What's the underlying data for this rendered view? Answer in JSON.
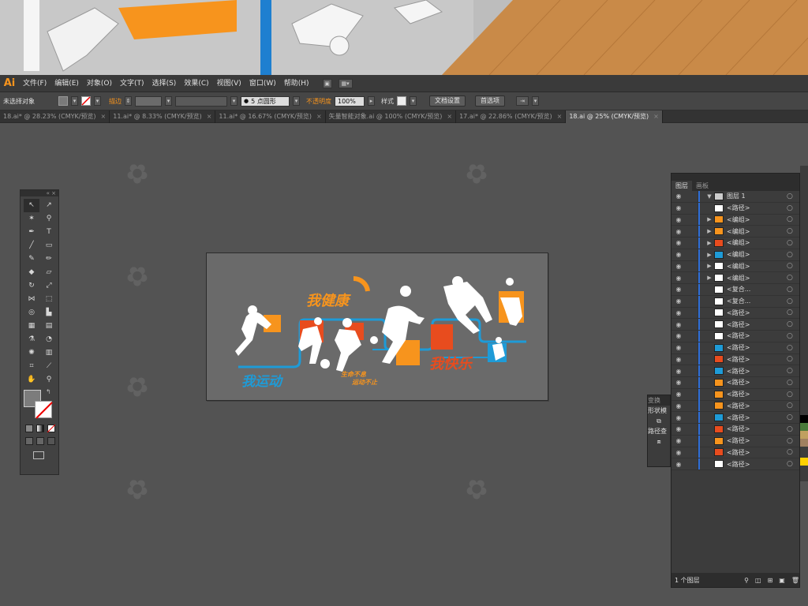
{
  "app": {
    "logo": "Ai"
  },
  "menu": [
    "文件(F)",
    "编辑(E)",
    "对象(O)",
    "文字(T)",
    "选择(S)",
    "效果(C)",
    "视图(V)",
    "窗口(W)",
    "帮助(H)"
  ],
  "control": {
    "selection": "未选择对象",
    "stroke_label": "描边",
    "point_style": "5 点圆形",
    "opacity_label": "不透明度",
    "opacity_value": "100%",
    "style_label": "样式",
    "doc_setup": "文档设置",
    "preferences": "首选项"
  },
  "tabs": [
    {
      "label": "18.ai* @ 28.23% (CMYK/预览)",
      "active": false
    },
    {
      "label": "11.ai* @ 8.33% (CMYK/预览)",
      "active": false
    },
    {
      "label": "11.ai* @ 16.67% (CMYK/预览)",
      "active": false
    },
    {
      "label": "矢量智能对象.ai @ 100% (CMYK/预览)",
      "active": false
    },
    {
      "label": "17.ai* @ 22.86% (CMYK/预览)",
      "active": false
    },
    {
      "label": "18.ai @ 25% (CMYK/预览)",
      "active": true
    }
  ],
  "artwork": {
    "title1": "我健康",
    "title2": "我快乐",
    "title3": "我运动",
    "slogan1": "生命不息",
    "slogan2": "运动不止"
  },
  "layers_panel": {
    "tab_layers": "图层",
    "tab_artboards": "画板",
    "top_layer": "图层 1",
    "rows": [
      {
        "name": "<路径>",
        "expand": false,
        "thumb": "#ffffff"
      },
      {
        "name": "<编组>",
        "expand": true,
        "thumb": "#f7941d"
      },
      {
        "name": "<编组>",
        "expand": true,
        "thumb": "#f7941d"
      },
      {
        "name": "<编组>",
        "expand": true,
        "thumb": "#e84c1e"
      },
      {
        "name": "<编组>",
        "expand": true,
        "thumb": "#1e9bd7"
      },
      {
        "name": "<编组>",
        "expand": true,
        "thumb": "#ffffff"
      },
      {
        "name": "<编组>",
        "expand": true,
        "thumb": "#ffffff"
      },
      {
        "name": "<复合...",
        "expand": false,
        "thumb": "#ffffff"
      },
      {
        "name": "<复合...",
        "expand": false,
        "thumb": "#ffffff"
      },
      {
        "name": "<路径>",
        "expand": false,
        "thumb": "#ffffff"
      },
      {
        "name": "<路径>",
        "expand": false,
        "thumb": "#ffffff"
      },
      {
        "name": "<路径>",
        "expand": false,
        "thumb": "#ffffff"
      },
      {
        "name": "<路径>",
        "expand": false,
        "thumb": "#1e9bd7"
      },
      {
        "name": "<路径>",
        "expand": false,
        "thumb": "#e84c1e"
      },
      {
        "name": "<路径>",
        "expand": false,
        "thumb": "#1e9bd7"
      },
      {
        "name": "<路径>",
        "expand": false,
        "thumb": "#f7941d"
      },
      {
        "name": "<路径>",
        "expand": false,
        "thumb": "#f7941d"
      },
      {
        "name": "<路径>",
        "expand": false,
        "thumb": "#f7941d"
      },
      {
        "name": "<路径>",
        "expand": false,
        "thumb": "#1e9bd7"
      },
      {
        "name": "<路径>",
        "expand": false,
        "thumb": "#e84c1e"
      },
      {
        "name": "<路径>",
        "expand": false,
        "thumb": "#f7941d"
      },
      {
        "name": "<路径>",
        "expand": false,
        "thumb": "#e84c1e"
      },
      {
        "name": "<路径>",
        "expand": false,
        "thumb": "#ffffff"
      }
    ],
    "footer": "1 个图层"
  },
  "mini_panel": {
    "transform": "变换",
    "shape": "形状模",
    "pathfinder": "路径查"
  },
  "colors": {
    "orange": "#f7941d",
    "red": "#e84c1e",
    "blue": "#1e9bd7",
    "white": "#ffffff"
  }
}
